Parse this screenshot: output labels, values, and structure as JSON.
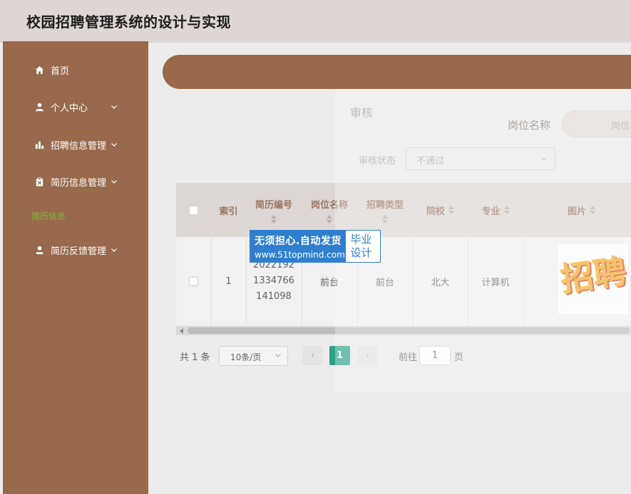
{
  "header": {
    "title": "校园招聘管理系统的设计与实现"
  },
  "sidebar": {
    "items": [
      {
        "label": "首页",
        "icon": "home-icon",
        "has_submenu": false
      },
      {
        "label": "个人中心",
        "icon": "user-icon",
        "has_submenu": true
      },
      {
        "label": "招聘信息管理",
        "icon": "bar-chart-icon",
        "has_submenu": true
      },
      {
        "label": "简历信息管理",
        "icon": "clipboard-icon",
        "has_submenu": true
      },
      {
        "label": "简历反馈管理",
        "icon": "user-upload-icon",
        "has_submenu": true
      }
    ],
    "active_subitem": "简历信息"
  },
  "search": {
    "label": "岗位名称",
    "placeholder": "岗位"
  },
  "table": {
    "columns": [
      "索引",
      "简历编号",
      "岗位名称",
      "招聘类型",
      "院校",
      "专业",
      "图片"
    ],
    "rows": [
      {
        "index": "1",
        "resume_no_line1": "2022192",
        "resume_no_line2": "1334766",
        "resume_no_line3": "141098",
        "position": "前台",
        "recruit_type": "前台",
        "school": "北大",
        "major": "计算机",
        "image_text": "招聘"
      }
    ]
  },
  "pagination": {
    "total": "共 1 条",
    "page_size": "10条/页",
    "prev": "‹",
    "current": "1",
    "next": "›",
    "goto_label": "前往",
    "goto_value": "1",
    "page_suffix": "页"
  },
  "dialog": {
    "title": "审核",
    "status_label": "审核状态",
    "status_value": "不通过"
  },
  "watermark": {
    "line1": "无须担心.自动发货",
    "line2": "www.51topmind.com",
    "right_line1": "毕业",
    "right_line2": "设计"
  },
  "colors": {
    "sidebar": "#98694a",
    "header": "#ddd6d2",
    "accent_green": "#2aa286",
    "submenu_text": "#7bbf3a"
  }
}
